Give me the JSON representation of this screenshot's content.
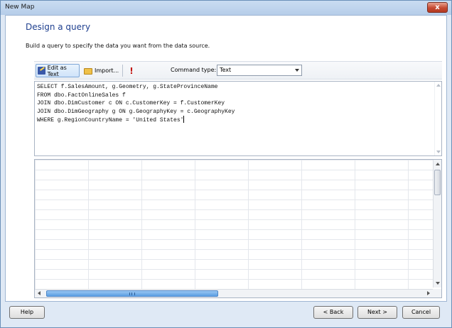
{
  "window": {
    "title": "New Map",
    "close_glyph": "x"
  },
  "page": {
    "heading": "Design a query",
    "instructions": "Build a query to specify the data you want from the data source."
  },
  "toolbar": {
    "edit_as_text": "Edit as Text",
    "import": "Import...",
    "run_glyph": "!",
    "command_type_label": "Command type:",
    "command_type_value": "Text"
  },
  "query": {
    "lines": [
      "SELECT f.SalesAmount, g.Geometry, g.StateProvinceName",
      "FROM dbo.FactOnlineSales f",
      "JOIN dbo.DimCustomer c ON c.CustomerKey = f.CustomerKey",
      "JOIN dbo.DimGeography g ON g.GeographyKey = c.GeographyKey",
      "WHERE g.RegionCountryName = 'United States'"
    ]
  },
  "buttons": {
    "help": "Help",
    "back": "< Back",
    "next": "Next >",
    "cancel": "Cancel"
  },
  "icons": [
    "edit-icon",
    "folder-icon",
    "run-icon",
    "close-icon",
    "dropdown-arrow-icon"
  ],
  "colors": {
    "heading": "#1e3f8f",
    "frame": "#bcd2e8",
    "close": "#c54a31",
    "scroll_thumb": "#5b9ee3"
  }
}
